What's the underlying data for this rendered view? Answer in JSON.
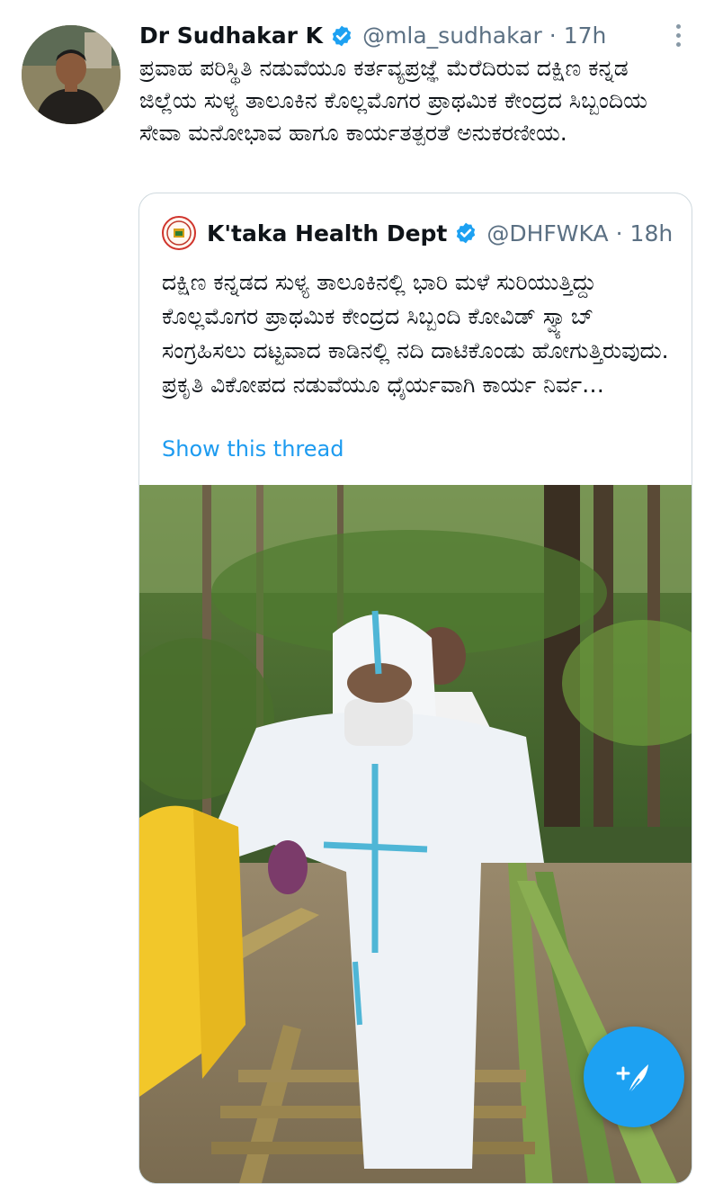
{
  "tweet": {
    "author_name": "Dr Sudhakar K",
    "handle": "@mla_sudhakar",
    "separator": "·",
    "time": "17h",
    "text": "ಪ್ರವಾಹ ಪರಿಸ್ಥಿತಿ ನಡುವೆಯೂ ಕರ್ತವ್ಯಪ್ರಜ್ಞೆ ಮೆರೆದಿರುವ ದಕ್ಷಿಣ ಕನ್ನಡ ಜಿಲ್ಲೆಯ ಸುಳ್ಯ ತಾಲೂಕಿನ ಕೊಲ್ಲಮೊಗರ ಪ್ರಾಥಮಿಕ ಕೇಂದ್ರದ ಸಿಬ್ಬಂದಿಯ ಸೇವಾ ಮನೋಭಾವ ಹಾಗೂ ಕಾರ್ಯತತ್ಪರತೆ ಅನುಕರಣೀಯ."
  },
  "quoted": {
    "author_name": "K'taka Health Dept",
    "handle": "@DHFWKA",
    "separator": "·",
    "time": "18h",
    "text": "ದಕ್ಷಿಣ ಕನ್ನಡದ ಸುಳ್ಯ ತಾಲೂಕಿನಲ್ಲಿ ಭಾರಿ ಮಳೆ ಸುರಿಯುತ್ತಿದ್ದು  ಕೊಲ್ಲಮೊಗರ ಪ್ರಾಥಮಿಕ ಕೇಂದ್ರದ ಸಿಬ್ಬಂದಿ ಕೋವಿಡ್ ಸ್ವ್ಯಾಬ್ ಸಂಗ್ರಹಿಸಲು ದಟ್ಟವಾದ ಕಾಡಿನಲ್ಲಿ ನದಿ ದಾಟಿಕೊಂಡು ಹೋಗುತ್ತಿರುವುದು. ಪ್ರಕೃತಿ ವಿಕೋಪದ ನಡುವೆಯೂ ಧೈರ್ಯವಾಗಿ ಕಾರ್ಯ ನಿರ್ವ…",
    "show_thread": "Show this thread"
  },
  "icons": {
    "verified": "verified-badge-icon",
    "more": "more-vertical-icon",
    "compose": "compose-tweet-icon"
  },
  "colors": {
    "accent": "#1da1f2",
    "link": "#1d9bf0",
    "muted_text": "#5b7083",
    "border": "#cfd9de"
  }
}
